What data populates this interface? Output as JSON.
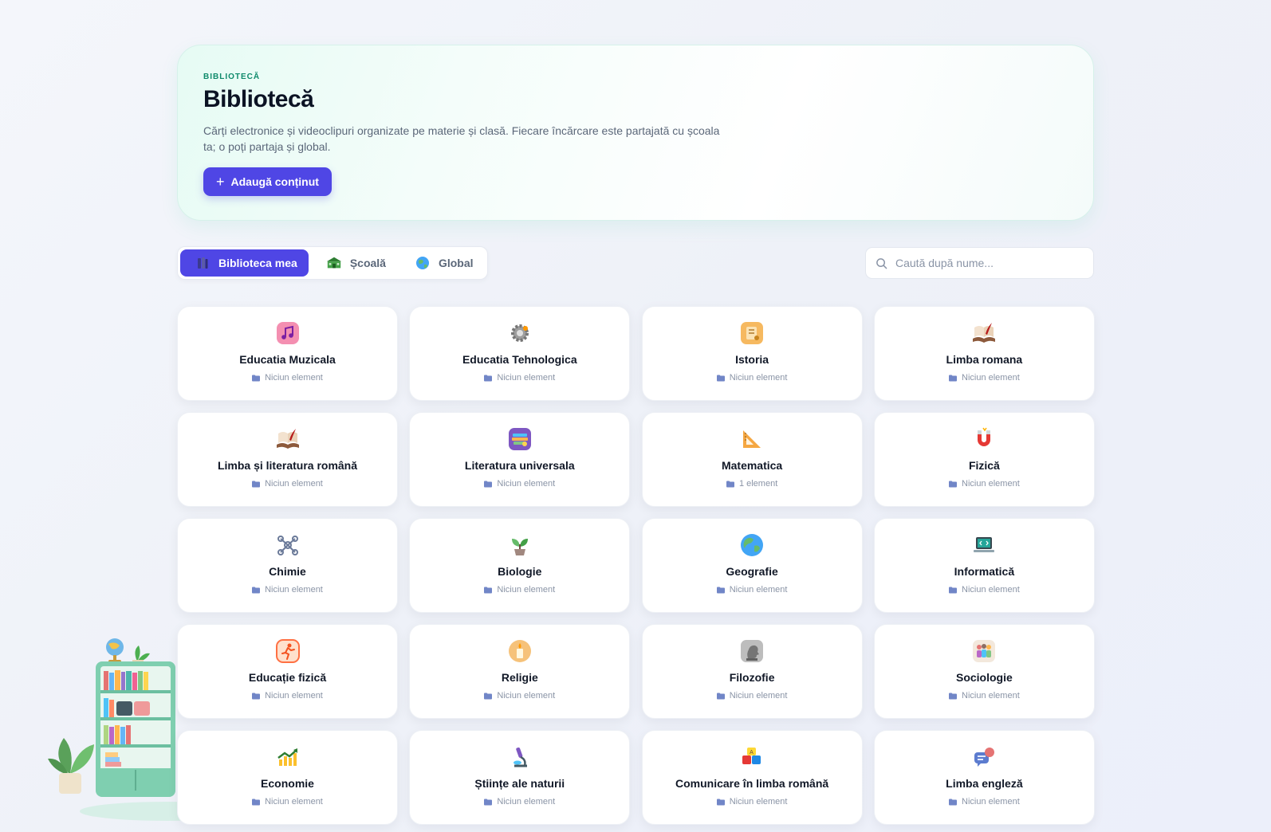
{
  "hero": {
    "eyebrow": "BIBLIOTECĂ",
    "title": "Bibliotecă",
    "description": "Cărți electronice și videoclipuri organizate pe materie și clasă. Fiecare încărcare este partajată cu școala ta; o poți partaja și global.",
    "add_button": "Adaugă conținut"
  },
  "tabs": [
    {
      "label": "Biblioteca mea",
      "icon": "books-icon",
      "active": true
    },
    {
      "label": "Școală",
      "icon": "school-icon",
      "active": false
    },
    {
      "label": "Global",
      "icon": "globe-icon",
      "active": false
    }
  ],
  "search": {
    "placeholder": "Caută după nume..."
  },
  "colors": {
    "accent": "#4f46e5",
    "eyebrow": "#0f8a6b"
  },
  "subjects": [
    {
      "name": "Educatia Muzicala",
      "count": "Niciun element",
      "icon": "music-note-icon"
    },
    {
      "name": "Educatia Tehnologica",
      "count": "Niciun element",
      "icon": "gear-icon"
    },
    {
      "name": "Istoria",
      "count": "Niciun element",
      "icon": "scroll-icon"
    },
    {
      "name": "Limba romana",
      "count": "Niciun element",
      "icon": "open-book-quill-icon"
    },
    {
      "name": "Limba și literatura română",
      "count": "Niciun element",
      "icon": "open-book-quill-icon"
    },
    {
      "name": "Literatura universala",
      "count": "Niciun element",
      "icon": "books-stack-icon"
    },
    {
      "name": "Matematica",
      "count": "1 element",
      "icon": "triangle-ruler-icon"
    },
    {
      "name": "Fizică",
      "count": "Niciun element",
      "icon": "magnet-icon"
    },
    {
      "name": "Chimie",
      "count": "Niciun element",
      "icon": "molecule-icon"
    },
    {
      "name": "Biologie",
      "count": "Niciun element",
      "icon": "seedling-icon"
    },
    {
      "name": "Geografie",
      "count": "Niciun element",
      "icon": "globe-icon"
    },
    {
      "name": "Informatică",
      "count": "Niciun element",
      "icon": "laptop-code-icon"
    },
    {
      "name": "Educație fizică",
      "count": "Niciun element",
      "icon": "running-person-icon"
    },
    {
      "name": "Religie",
      "count": "Niciun element",
      "icon": "candle-icon"
    },
    {
      "name": "Filozofie",
      "count": "Niciun element",
      "icon": "statue-head-icon"
    },
    {
      "name": "Sociologie",
      "count": "Niciun element",
      "icon": "people-group-icon"
    },
    {
      "name": "Economie",
      "count": "Niciun element",
      "icon": "chart-up-icon"
    },
    {
      "name": "Științe ale naturii",
      "count": "Niciun element",
      "icon": "microscope-icon"
    },
    {
      "name": "Comunicare în limba română",
      "count": "Niciun element",
      "icon": "letter-blocks-icon"
    },
    {
      "name": "Limba engleză",
      "count": "Niciun element",
      "icon": "speech-bubbles-icon"
    }
  ]
}
